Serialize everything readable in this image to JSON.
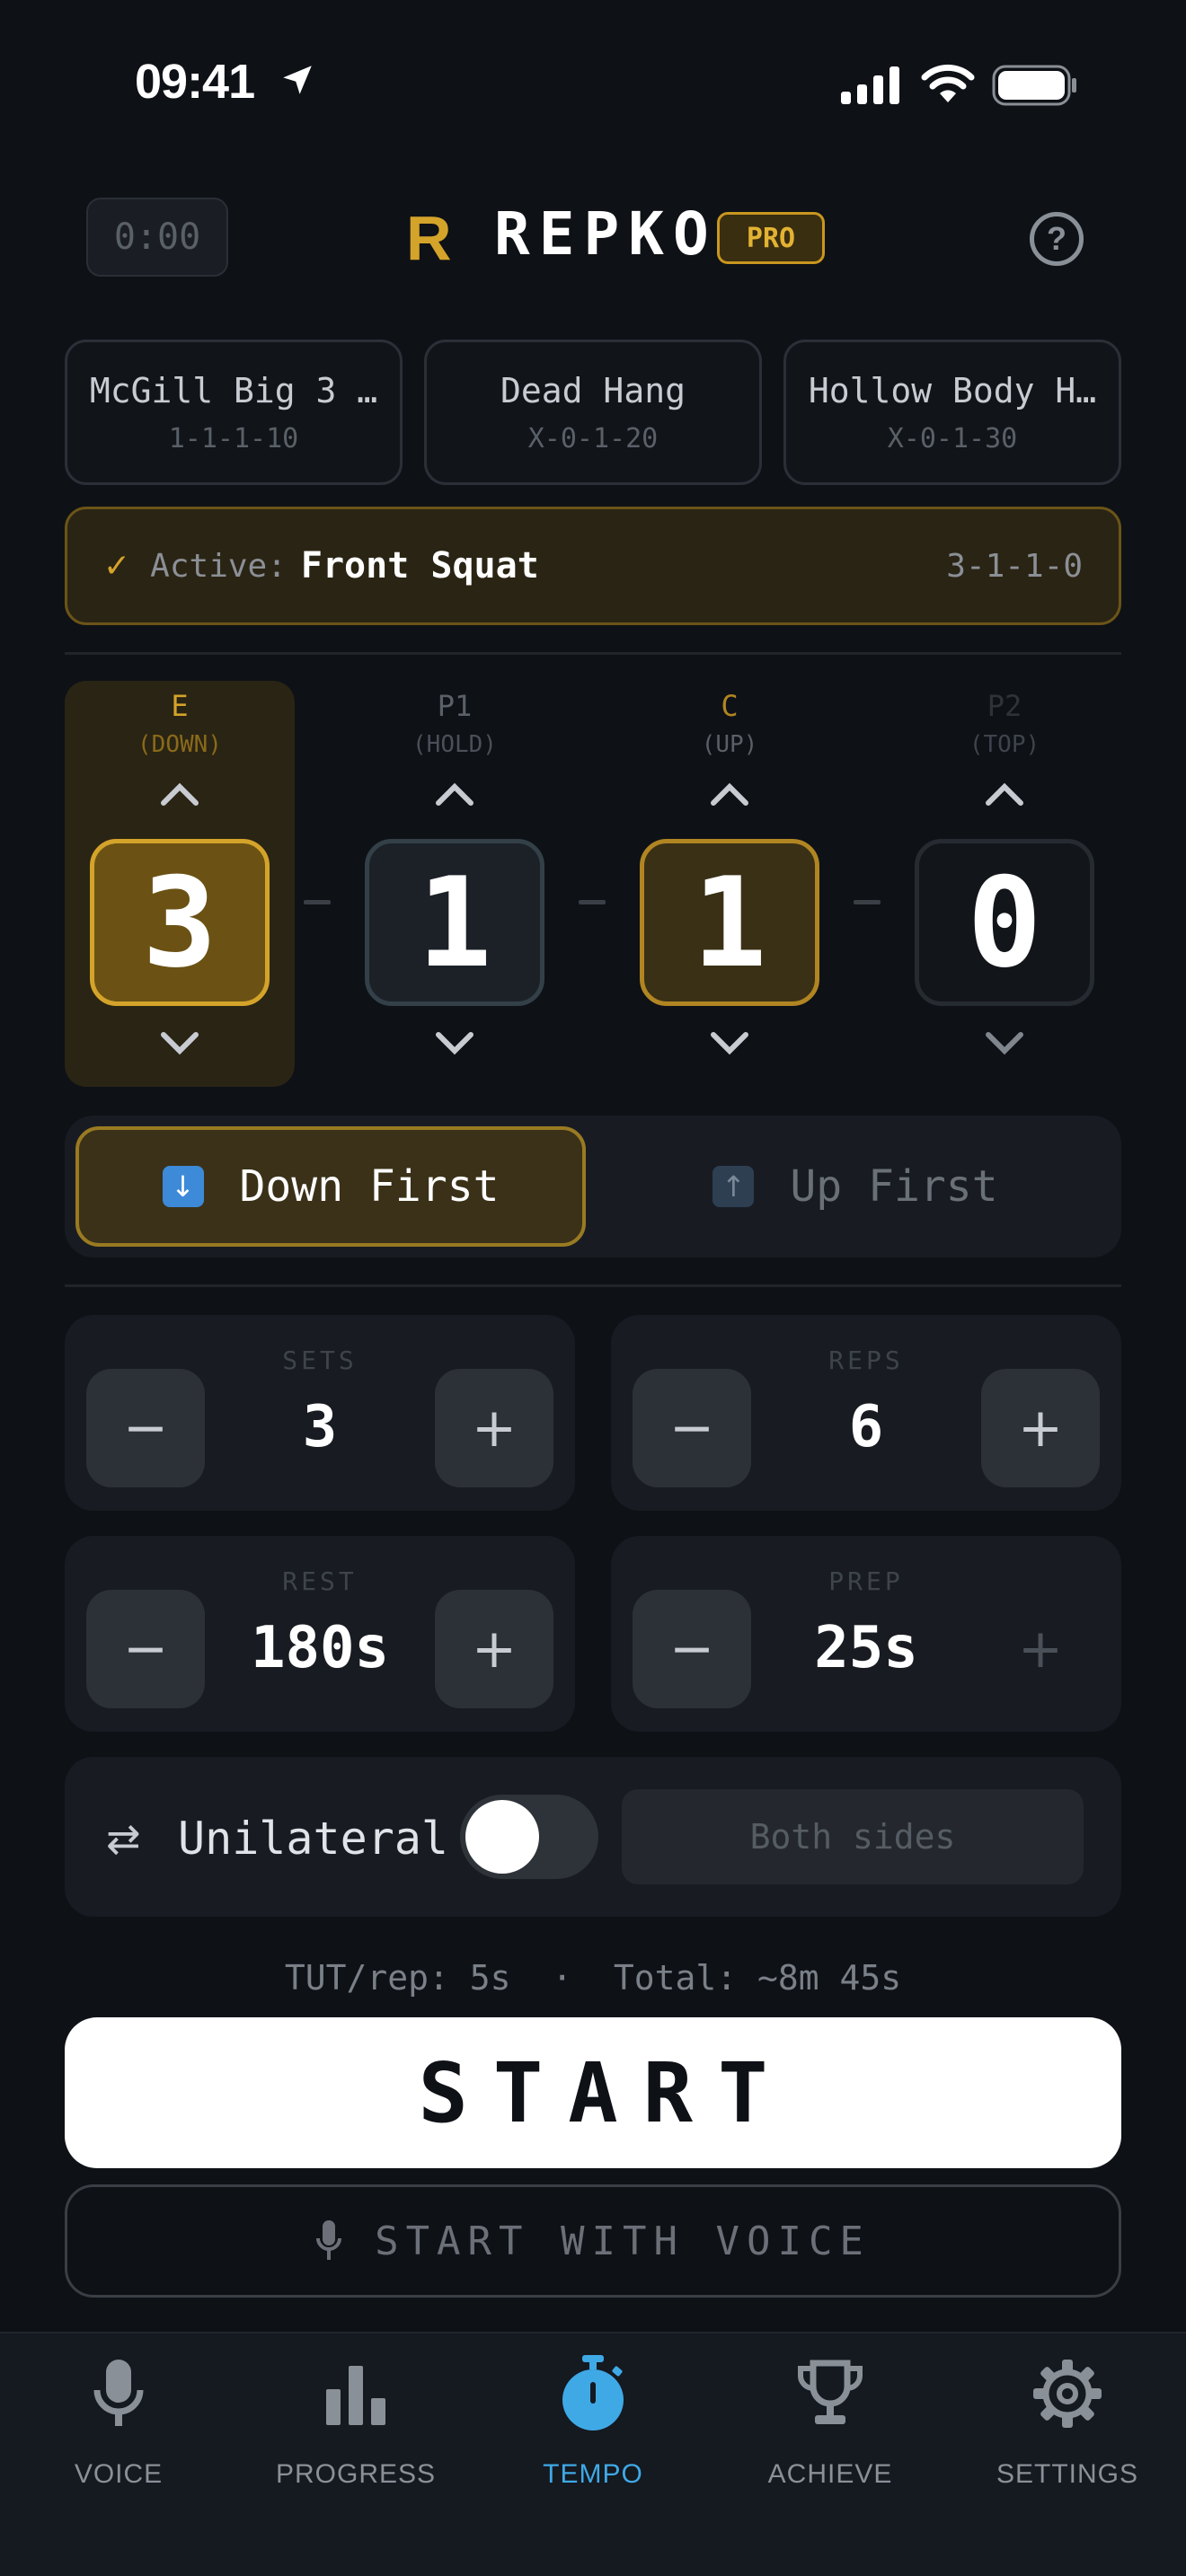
{
  "status_bar": {
    "time": "09:41"
  },
  "header": {
    "timer": "0:00",
    "logo_mark": "R",
    "app_name": "REPKO",
    "badge": "PRO",
    "help_icon": "question-circle-icon"
  },
  "presets": [
    {
      "name": "McGill Big 3 …",
      "code": "1-1-1-10"
    },
    {
      "name": "Dead Hang",
      "code": "X-0-1-20"
    },
    {
      "name": "Hollow Body H…",
      "code": "X-0-1-30"
    }
  ],
  "active": {
    "label": "Active:",
    "exercise": "Front Squat",
    "code": "3-1-1-0"
  },
  "tempo": {
    "phases": [
      {
        "key": "E",
        "sub": "(DOWN)",
        "value": "3"
      },
      {
        "key": "P1",
        "sub": "(HOLD)",
        "value": "1"
      },
      {
        "key": "C",
        "sub": "(UP)",
        "value": "1"
      },
      {
        "key": "P2",
        "sub": "(TOP)",
        "value": "0"
      }
    ]
  },
  "direction": {
    "down_first": "Down First",
    "up_first": "Up First",
    "selected": "down_first"
  },
  "steppers": {
    "sets": {
      "label": "SETS",
      "value": "3"
    },
    "reps": {
      "label": "REPS",
      "value": "6"
    },
    "rest": {
      "label": "REST",
      "value": "180s"
    },
    "prep": {
      "label": "PREP",
      "value": "25s"
    }
  },
  "unilateral": {
    "label": "Unilateral",
    "enabled": false,
    "sides": "Both sides"
  },
  "summary": {
    "text": "TUT/rep: 5s  ·  Total: ~8m 45s"
  },
  "actions": {
    "start": "START",
    "start_voice": "START WITH VOICE"
  },
  "tabs": [
    {
      "label": "VOICE",
      "icon": "microphone-icon",
      "active": false
    },
    {
      "label": "PROGRESS",
      "icon": "bar-chart-icon",
      "active": false
    },
    {
      "label": "TEMPO",
      "icon": "stopwatch-icon",
      "active": true
    },
    {
      "label": "ACHIEVE",
      "icon": "trophy-icon",
      "active": false
    },
    {
      "label": "SETTINGS",
      "icon": "gear-icon",
      "active": false
    }
  ],
  "colors": {
    "accent": "#d4a32a",
    "active_tab": "#3fa9e6",
    "background": "#0e1116"
  }
}
